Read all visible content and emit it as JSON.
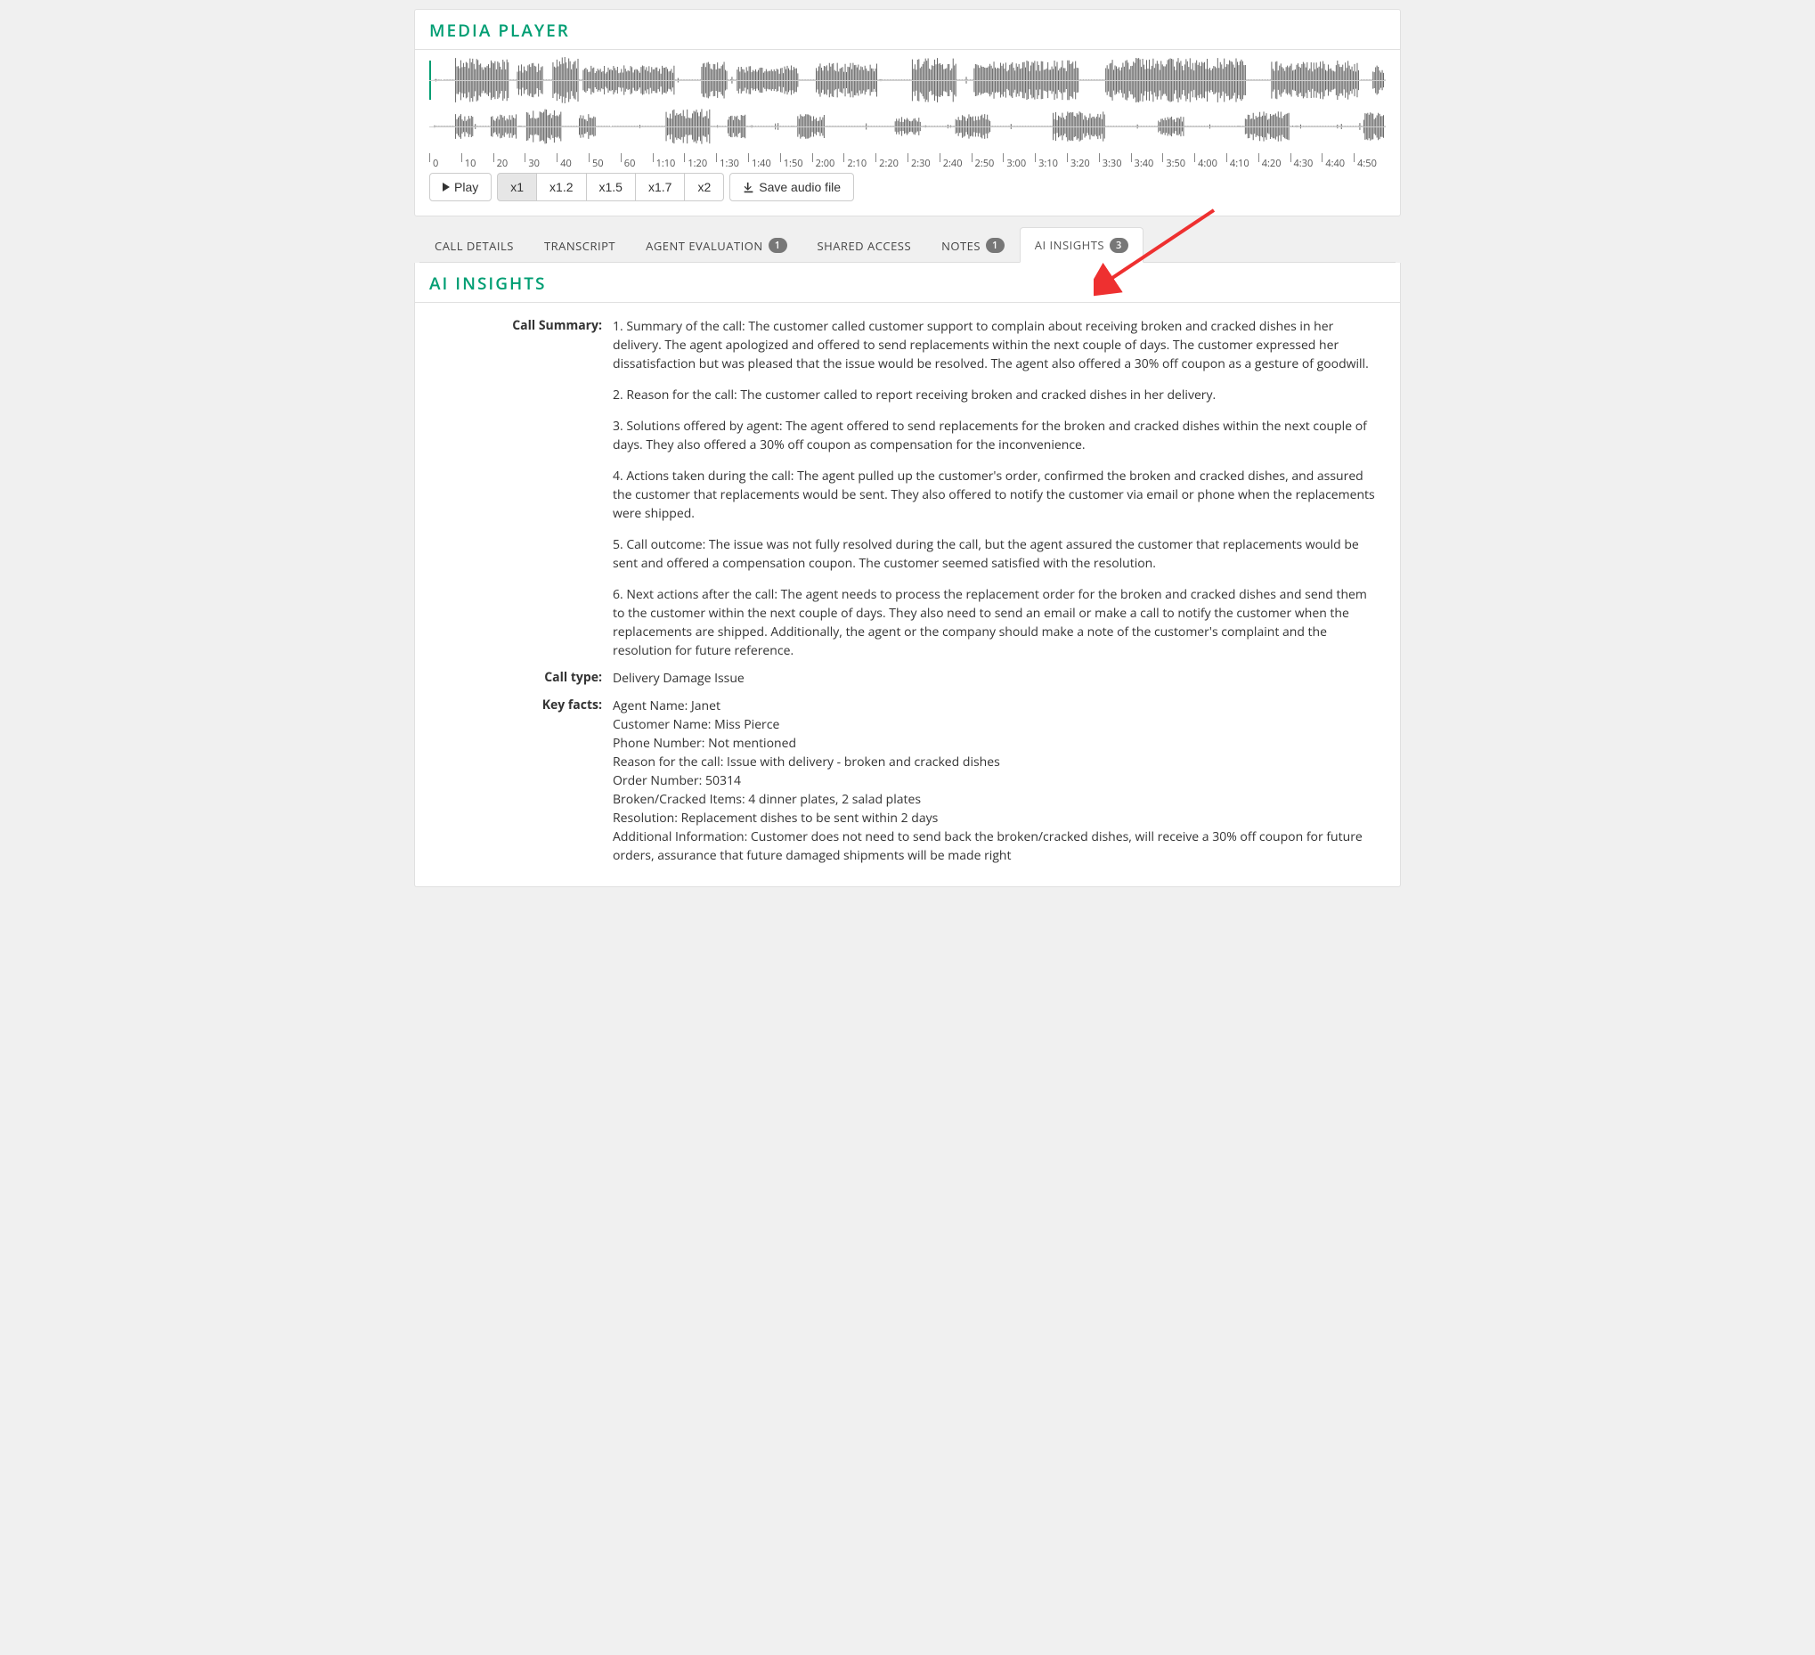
{
  "media_player": {
    "title": "MEDIA  PLAYER",
    "play_label": "Play",
    "speeds": [
      "x1",
      "x1.2",
      "x1.5",
      "x1.7",
      "x2"
    ],
    "active_speed_index": 0,
    "save_label": "Save audio file",
    "timeline": [
      "0",
      "10",
      "20",
      "30",
      "40",
      "50",
      "60",
      "1:10",
      "1:20",
      "1:30",
      "1:40",
      "1:50",
      "2:00",
      "2:10",
      "2:20",
      "2:30",
      "2:40",
      "2:50",
      "3:00",
      "3:10",
      "3:20",
      "3:30",
      "3:40",
      "3:50",
      "4:00",
      "4:10",
      "4:20",
      "4:30",
      "4:40",
      "4:50"
    ]
  },
  "tabs": [
    {
      "label": "CALL DETAILS",
      "badge": null,
      "active": false
    },
    {
      "label": "TRANSCRIPT",
      "badge": null,
      "active": false
    },
    {
      "label": "AGENT EVALUATION",
      "badge": "1",
      "active": false
    },
    {
      "label": "SHARED ACCESS",
      "badge": null,
      "active": false
    },
    {
      "label": "NOTES",
      "badge": "1",
      "active": false
    },
    {
      "label": "AI INSIGHTS",
      "badge": "3",
      "active": true
    }
  ],
  "ai_insights": {
    "title": "AI  INSIGHTS",
    "summary_label": "Call Summary:",
    "summary_paragraphs": [
      "1. Summary of the call: The customer called customer support to complain about receiving broken and cracked dishes in her delivery. The agent apologized and offered to send replacements within the next couple of days. The customer expressed her dissatisfaction but was pleased that the issue would be resolved. The agent also offered a 30% off coupon as a gesture of goodwill.",
      "2. Reason for the call: The customer called to report receiving broken and cracked dishes in her delivery.",
      "3. Solutions offered by agent: The agent offered to send replacements for the broken and cracked dishes within the next couple of days. They also offered a 30% off coupon as compensation for the inconvenience.",
      "4. Actions taken during the call: The agent pulled up the customer's order, confirmed the broken and cracked dishes, and assured the customer that replacements would be sent. They also offered to notify the customer via email or phone when the replacements were shipped.",
      "5. Call outcome: The issue was not fully resolved during the call, but the agent assured the customer that replacements would be sent and offered a compensation coupon. The customer seemed satisfied with the resolution.",
      "6. Next actions after the call: The agent needs to process the replacement order for the broken and cracked dishes and send them to the customer within the next couple of days. They also need to send an email or make a call to notify the customer when the replacements are shipped. Additionally, the agent or the company should make a note of the customer's complaint and the resolution for future reference."
    ],
    "call_type_label": "Call type:",
    "call_type_value": "Delivery Damage Issue",
    "key_facts_label": "Key facts:",
    "key_facts": [
      "Agent Name: Janet",
      "Customer Name: Miss Pierce",
      "Phone Number: Not mentioned",
      "Reason for the call: Issue with delivery - broken and cracked dishes",
      "Order Number: 50314",
      "Broken/Cracked Items: 4 dinner plates, 2 salad plates",
      "Resolution: Replacement dishes to be sent within 2 days",
      "Additional Information: Customer does not need to send back the broken/cracked dishes, will receive a 30% off coupon for future orders, assurance that future damaged shipments will be made right"
    ]
  }
}
